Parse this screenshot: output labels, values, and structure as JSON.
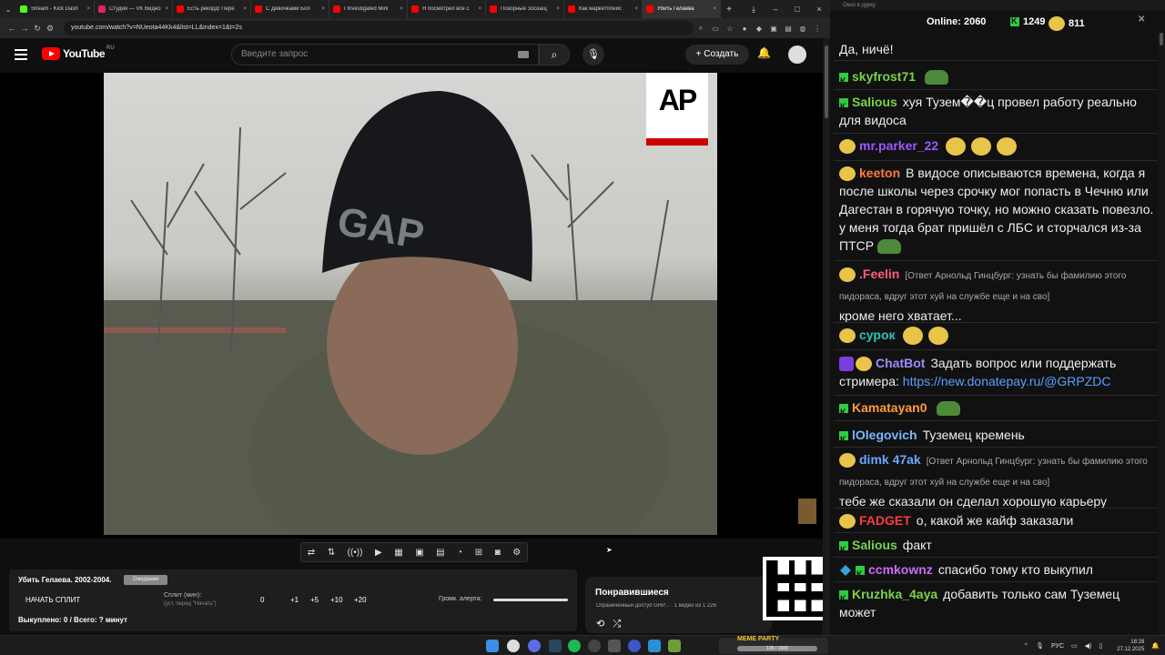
{
  "browser": {
    "tabs": [
      {
        "label": "Stream - Kick Dash",
        "color": "#53fc18"
      },
      {
        "label": "Студия — VK Видео",
        "color": "#0077ff"
      },
      {
        "label": "Есть рекорд! Пере",
        "color": "#ff0000"
      },
      {
        "label": "С Девочками Бол",
        "color": "#ff0000"
      },
      {
        "label": "I Investigated Mini",
        "color": "#ff0000"
      },
      {
        "label": "Я посмотрел все с",
        "color": "#ff0000"
      },
      {
        "label": "Позорные Зоозащ",
        "color": "#ff0000"
      },
      {
        "label": "Как маркетплейс",
        "color": "#ff0000"
      },
      {
        "label": "Убить Гелаева",
        "color": "#ff0000"
      }
    ],
    "url": "youtube.com/watch?v=NUeota44Kk4&list=LL&index=1&t=2s"
  },
  "youtube": {
    "logo_text": "YouTube",
    "region": "RU",
    "search_placeholder": "Введите запрос",
    "create_label": "Создать"
  },
  "video": {
    "watermark": "AP"
  },
  "extension": {
    "title": "Убить Гелаева. 2002-2004.",
    "badge": "Ожидание",
    "start_split": "НАЧАТЬ СПЛИТ",
    "split_label": "Сплит (мин):",
    "split_hint": "(уст. перед \"Начать\")",
    "split_values": [
      "0",
      "+1",
      "+5",
      "+10",
      "+20"
    ],
    "volume_label": "Громк. алерта:",
    "volume_level": 1.0,
    "bought": "Выкуплено: 0 / Всего: ? минут"
  },
  "liked": {
    "header": "Понравившиеся",
    "subtitle": "Ограниченный доступ GRP... · 1 видео из 1 226"
  },
  "chat_window": {
    "title": "Окно в дурку",
    "online_label": "Online:",
    "online_count": "2060",
    "kick_count": "1249",
    "points_count": "811"
  },
  "chat": [
    {
      "user": "",
      "text": "Да, ничё!"
    },
    {
      "user": "skyfrost71",
      "text": "",
      "color": "#7ad14b"
    },
    {
      "user": "Salious",
      "text": "хуя Тузем��ц провел работу реально для видоса",
      "color": "#7ad14b"
    },
    {
      "user": "mr.parker_22",
      "text": "",
      "color": "#9b59ff"
    },
    {
      "user": "keeton",
      "text": "В видосе описываются времена, когда я после школы через срочку мог попасть в Чечню или Дагестан в горячую точку, но можно сказать повезло. у меня тогда брат пришёл с ЛБС и сторчался из-за ПТСР",
      "color": "#ff7a3c"
    },
    {
      "user": ".Feelin",
      "reply": "[Ответ Арнольд Гинцбург: узнать бы фамилию этого пидораса, вдруг этот хуй на службе еще и на сво]",
      "text": "кроме него хватает...",
      "color": "#ff5f7a"
    },
    {
      "user": "сурок",
      "text": "",
      "color": "#2ec4b6"
    },
    {
      "user": "ChatBot",
      "text": "Задать вопрос или поддержать стримера:",
      "link": "https://new.donatepay.ru/@GRPZDC",
      "color": "#9b8cff"
    },
    {
      "user": "Kamatayan0",
      "text": "",
      "color": "#ff9b3c"
    },
    {
      "user": "lOlegovich",
      "text": "Туземец кремень",
      "color": "#7ab8ff"
    },
    {
      "user": "dimk 47ak",
      "reply": "[Ответ Арнольд Гинцбург: узнать бы фамилию этого пидораса, вдруг этот хуй на службе еще и на сво]",
      "text": "тебе же сказали он сделал хорошую карьеру",
      "color": "#6aa8ff"
    },
    {
      "user": "FADGET",
      "text": "о, какой же кайф заказали",
      "color": "#ff3c3c"
    },
    {
      "user": "Salious",
      "text": "факт",
      "color": "#7ad14b"
    },
    {
      "user": "ccmkownz",
      "text": "спасибо тому кто выкупил",
      "color": "#c86bff"
    },
    {
      "user": "Kruzhka_4aya",
      "text": "добавить только сам Туземец может",
      "color": "#7ad14b"
    }
  ],
  "taskbar": {
    "widget_title": "MEME PARTY",
    "widget_progress": "135 / 1500",
    "lang": "РУС",
    "time": "18:28",
    "date": "27.12.2025"
  }
}
